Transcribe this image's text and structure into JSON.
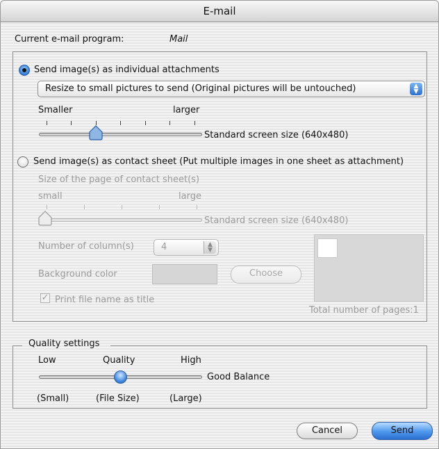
{
  "window": {
    "title": "E-mail"
  },
  "current_program": {
    "label": "Current e-mail program:",
    "value": "Mail"
  },
  "individual": {
    "radio_label": "Send image(s) as individual attachments",
    "selected": true,
    "resize_popup": "Resize to small pictures to send (Original pictures will be untouched)",
    "slider_min_label": "Smaller",
    "slider_max_label": "larger",
    "slider_value_label": "Standard screen size (640x480)"
  },
  "contact_sheet": {
    "radio_label": "Send image(s) as contact sheet (Put multiple images in one sheet as attachment)",
    "selected": false,
    "page_size_label": "Size of the page of contact sheet(s)",
    "slider_min_label": "small",
    "slider_max_label": "large",
    "slider_value_label": "Standard screen size (640x480)",
    "columns_label": "Number of column(s)",
    "columns_value": "4",
    "background_label": "Background color",
    "choose_label": "Choose",
    "print_name_label": "Print file name as title",
    "print_name_checked": true,
    "total_pages_label": "Total number of pages:1"
  },
  "quality": {
    "group_label": "Quality settings",
    "low_label": "Low",
    "mid_label": "Quality",
    "high_label": "High",
    "value_label": "Good Balance",
    "small_label": "(Small)",
    "filesize_label": "(File Size)",
    "large_label": "(Large)"
  },
  "buttons": {
    "cancel": "Cancel",
    "send": "Send"
  },
  "colors": {
    "accent": "#2f7bd6",
    "disabled_text": "#9a9a9a"
  }
}
